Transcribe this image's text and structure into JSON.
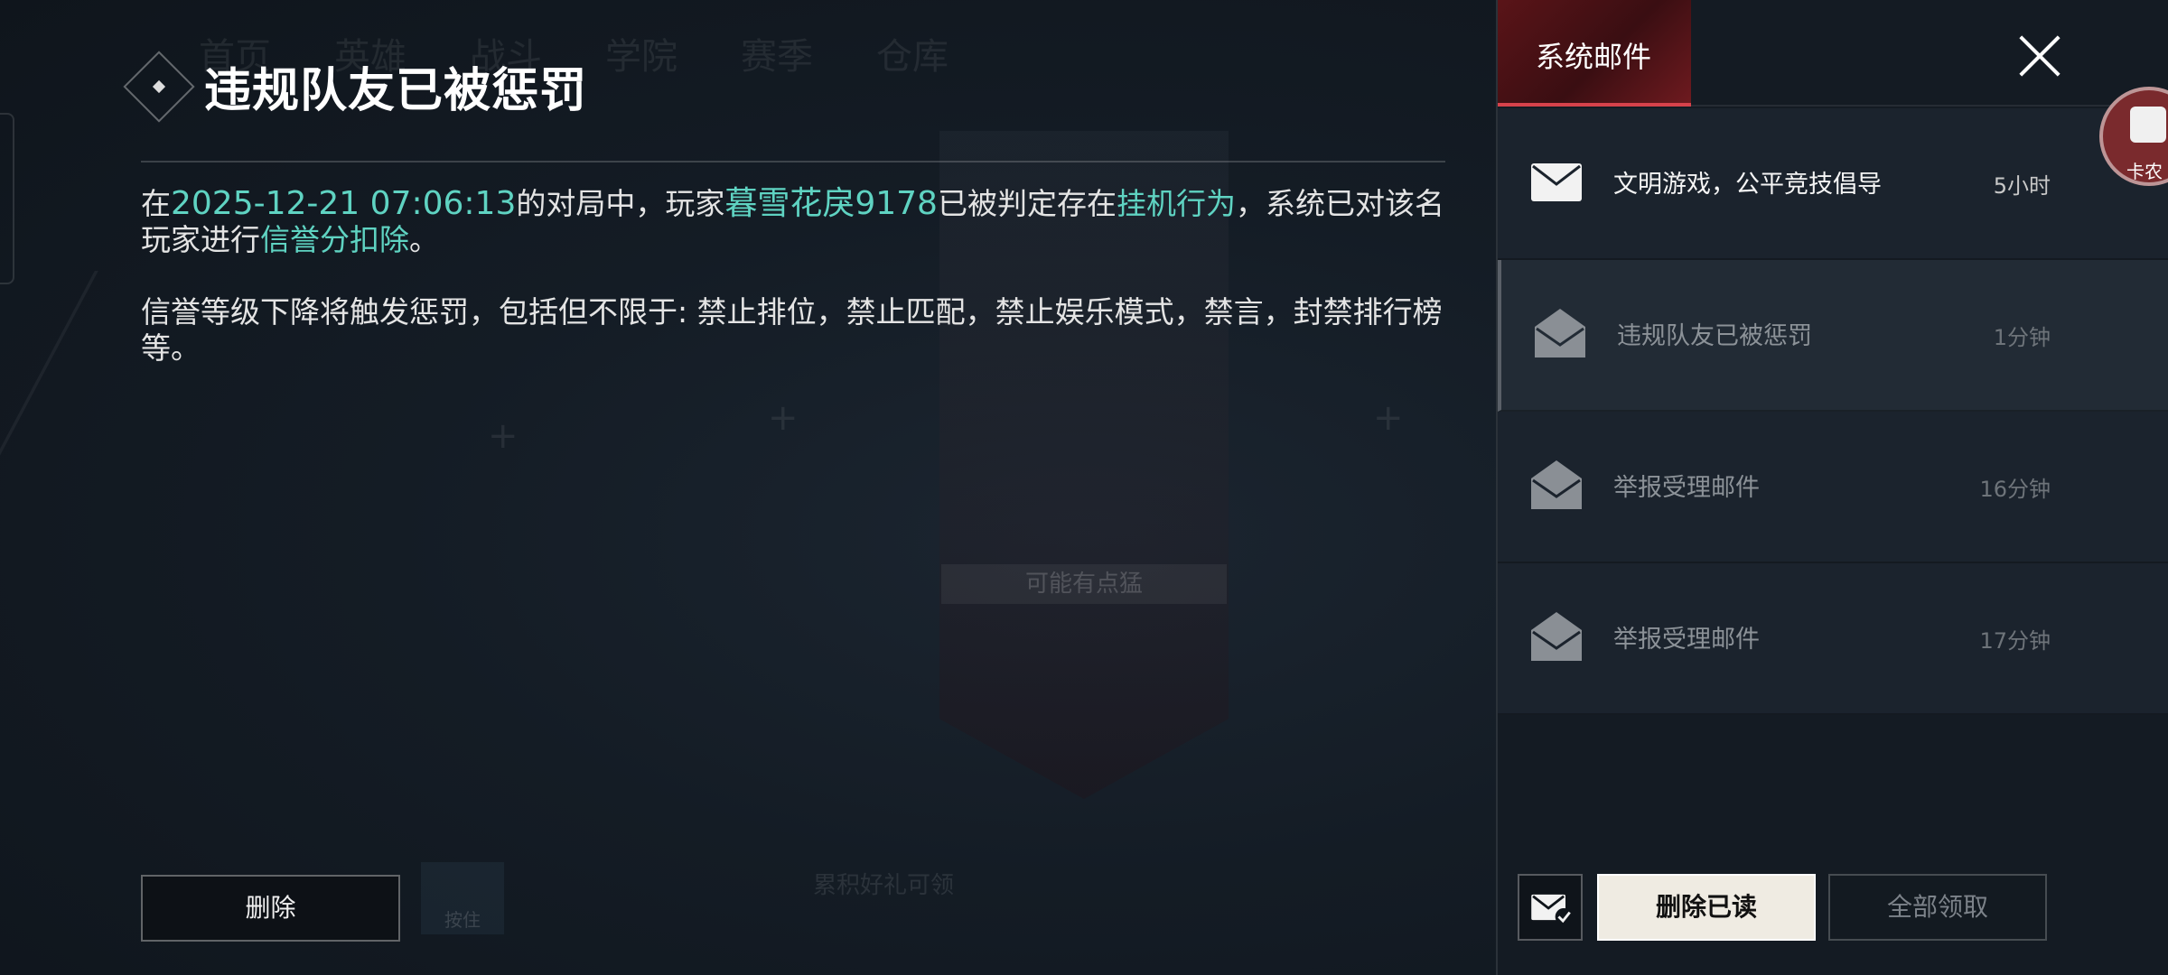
{
  "detail": {
    "title": "违规队友已被惩罚",
    "p1_prefix": "在",
    "p1_datetime": "2025-12-21 07:06:13",
    "p1_mid1": "的对局中，玩家",
    "p1_player": "暮雪花戾9178",
    "p1_mid2": "已被判定存在",
    "p1_behavior": "挂机行为",
    "p1_mid3": "，系统已对该名玩家进行",
    "p1_action": "信誉分扣除",
    "p1_suffix": "。",
    "p2": "信誉等级下降将触发惩罚，包括但不限于: 禁止排位，禁止匹配，禁止娱乐模式，禁言，封禁排行榜等。",
    "delete_label": "删除"
  },
  "panel": {
    "tab_label": "系统邮件",
    "avatar_text": "卡农"
  },
  "mails": [
    {
      "subject": "文明游戏，公平竞技倡导",
      "time": "5小时",
      "state": "unread"
    },
    {
      "subject": "违规队友已被惩罚",
      "time": "1分钟",
      "state": "read-selected"
    },
    {
      "subject": "举报受理邮件",
      "time": "16分钟",
      "state": "read"
    },
    {
      "subject": "举报受理邮件",
      "time": "17分钟",
      "state": "read"
    }
  ],
  "footer": {
    "delete_read_label": "删除已读",
    "claim_all_label": "全部领取"
  },
  "background": {
    "tabs": [
      "首页",
      "英雄",
      "战斗",
      "学院",
      "赛季",
      "仓库"
    ],
    "banner_tag": "可能有点猛",
    "bottom_text": "累积好礼可领",
    "mic_label": "按住"
  },
  "colors": {
    "highlight": "#5fd3c2",
    "tab_accent": "#d7424b"
  }
}
